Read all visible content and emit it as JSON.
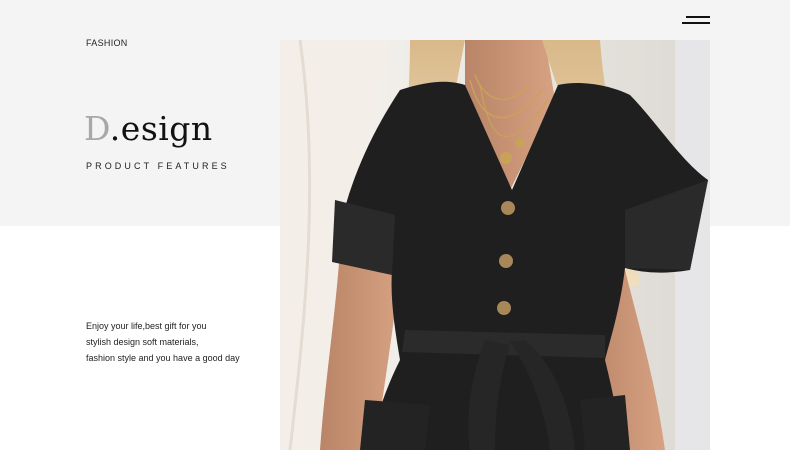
{
  "header": {
    "menu_icon": "menu-icon"
  },
  "hero": {
    "category": "FASHION",
    "title_initial": "D",
    "title_rest": ".esign",
    "subtitle": "PRODUCT FEATURES"
  },
  "description": {
    "lines": [
      "Enjoy your life,best gift for you",
      "stylish design soft materials,",
      "fashion style and you have a good day"
    ]
  },
  "colors": {
    "band": "#f4f4f4",
    "garment": "#1f1f1f",
    "accent_gray": "#a8a8a8"
  }
}
